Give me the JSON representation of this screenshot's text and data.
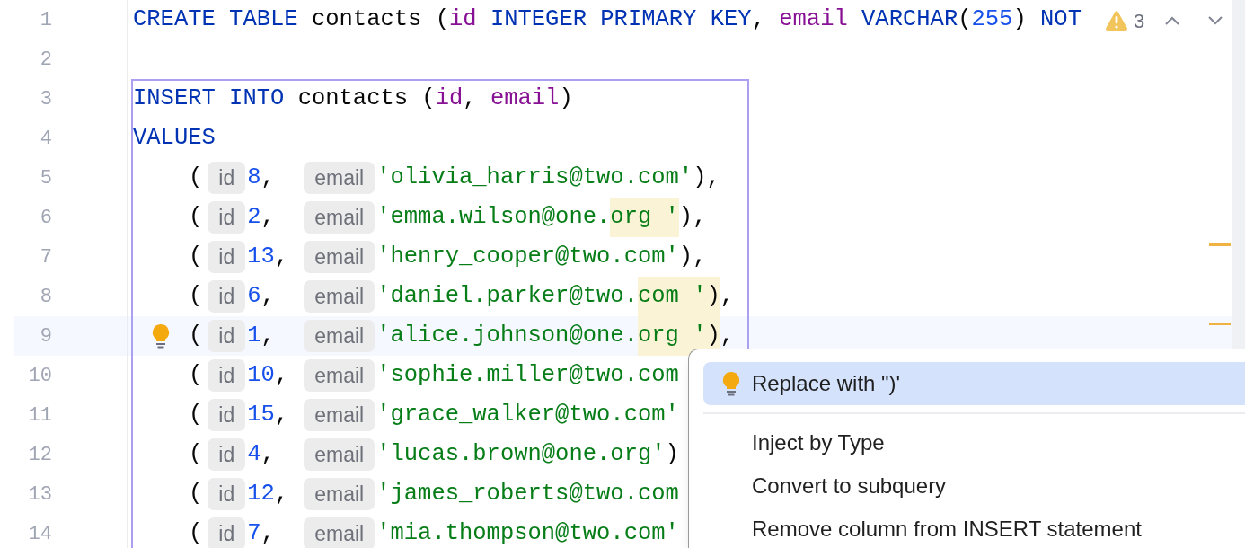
{
  "editor": {
    "lines": [
      {
        "number": "1",
        "tokens": [
          {
            "text": "CREATE TABLE",
            "kind": "keyword"
          },
          {
            "text": " contacts (",
            "kind": "plain"
          },
          {
            "text": "id",
            "kind": "column"
          },
          {
            "text": " INTEGER PRIMARY KEY",
            "kind": "keyword"
          },
          {
            "text": ", ",
            "kind": "plain"
          },
          {
            "text": "email",
            "kind": "column"
          },
          {
            "text": " VARCHAR",
            "kind": "keyword"
          },
          {
            "text": "(",
            "kind": "plain"
          },
          {
            "text": "255",
            "kind": "number"
          },
          {
            "text": ") ",
            "kind": "plain"
          },
          {
            "text": "NOT",
            "kind": "keyword"
          }
        ]
      },
      {
        "number": "2"
      },
      {
        "number": "3",
        "tokens": [
          {
            "text": "INSERT INTO",
            "kind": "keyword"
          },
          {
            "text": " contacts (",
            "kind": "plain"
          },
          {
            "text": "id",
            "kind": "column"
          },
          {
            "text": ", ",
            "kind": "plain"
          },
          {
            "text": "email",
            "kind": "column"
          },
          {
            "text": ")",
            "kind": "plain"
          }
        ]
      },
      {
        "number": "4",
        "tokens": [
          {
            "text": "VALUES",
            "kind": "keyword"
          }
        ]
      },
      {
        "number": "5",
        "row": {
          "open": "(",
          "id_hint": "id",
          "id": "8,",
          "email_hint": "email",
          "email": "'olivia_harris@two.com'",
          "tail": "),"
        }
      },
      {
        "number": "6",
        "row": {
          "open": "(",
          "id_hint": "id",
          "id": "2,",
          "email_hint": "email",
          "email": "'emma.wilson@one.",
          "flagged": "org '",
          "tail": "),"
        }
      },
      {
        "number": "7",
        "row": {
          "open": "(",
          "id_hint": "id",
          "id": "13,",
          "email_hint": "email",
          "email": "'henry_cooper@two.com'",
          "tail": "),"
        }
      },
      {
        "number": "8",
        "row": {
          "open": "(",
          "id_hint": "id",
          "id": "6,",
          "email_hint": "email",
          "email": "'daniel.parker@two.",
          "flagged": "com ')",
          "tail": ","
        }
      },
      {
        "number": "9",
        "current": true,
        "row": {
          "open": "(",
          "id_hint": "id",
          "id": "1,",
          "email_hint": "email",
          "email": "'alice.johnson@one.",
          "flagged": "org ')",
          "tail": ","
        }
      },
      {
        "number": "10",
        "row": {
          "open": "(",
          "id_hint": "id",
          "id": "10,",
          "email_hint": "email",
          "email": "'sophie.miller@two.com"
        }
      },
      {
        "number": "11",
        "row": {
          "open": "(",
          "id_hint": "id",
          "id": "15,",
          "email_hint": "email",
          "email": "'grace_walker@two.com'"
        }
      },
      {
        "number": "12",
        "row": {
          "open": "(",
          "id_hint": "id",
          "id": "4,",
          "email_hint": "email",
          "email": "'lucas.brown@one.org'",
          "tail": ")"
        }
      },
      {
        "number": "13",
        "row": {
          "open": "(",
          "id_hint": "id",
          "id": "12,",
          "email_hint": "email",
          "email": "'james_roberts@two.com"
        }
      },
      {
        "number": "14",
        "row": {
          "open": "(",
          "id_hint": "id",
          "id": "7,",
          "email_hint": "email",
          "email": "'mia.thompson@two.com'"
        }
      }
    ]
  },
  "inspections": {
    "warning_count": "3"
  },
  "popup": {
    "items": [
      {
        "label": "Replace with \")'",
        "kind": "quickfix",
        "selected": true
      },
      {
        "label": "Inject by Type",
        "kind": "action",
        "selected": false
      },
      {
        "label": "Convert to subquery",
        "kind": "action",
        "selected": false
      },
      {
        "label": "Remove column from INSERT statement",
        "kind": "action",
        "selected": false
      }
    ]
  }
}
